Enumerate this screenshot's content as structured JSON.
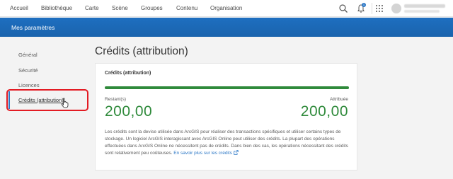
{
  "nav": {
    "items": [
      "Accueil",
      "Bibliothèque",
      "Carte",
      "Scène",
      "Groupes",
      "Contenu",
      "Organisation"
    ],
    "notification_count": "1"
  },
  "header": {
    "title": "Mes paramètres"
  },
  "sidebar": {
    "items": [
      "Général",
      "Sécurité",
      "Licences",
      "Crédits (attribution)"
    ],
    "active": "Crédits (attribution)"
  },
  "main": {
    "page_title": "Crédits (attribution)",
    "card": {
      "title": "Crédits (attribution)",
      "remaining_label": "Restant(s)",
      "remaining_value": "200,00",
      "allocated_label": "Attribuée",
      "allocated_value": "200,00",
      "progress_fraction": 1.0,
      "description": "Les crédits sont la devise utilisée dans ArcGIS pour réaliser des transactions spécifiques et utiliser certains types de stockage. Un logiciel ArcGIS interagissant avec ArcGIS Online peut utiliser des crédits. La plupart des opérations effectuées dans ArcGIS Online ne nécessitent pas de crédits. Dans bien des cas, les opérations nécessitant des crédits sont relativement peu coûteuses.",
      "link_text": "En savoir plus sur les crédits"
    }
  },
  "colors": {
    "header_blue": "#1e6fc0",
    "credit_green": "#2f8a3b",
    "highlight_red": "#e31b23",
    "link_blue": "#2d78c6"
  }
}
